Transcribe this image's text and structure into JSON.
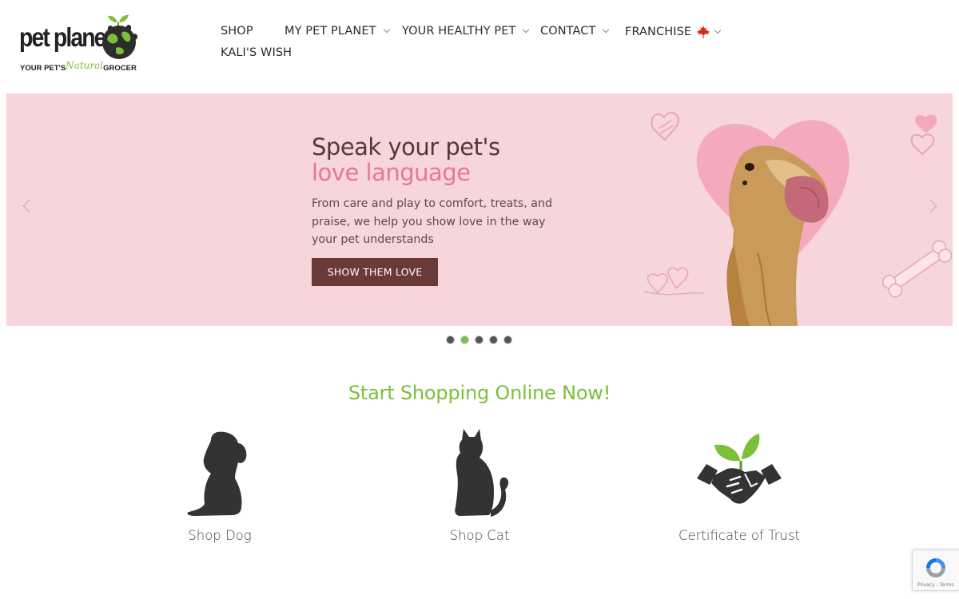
{
  "logo": {
    "brand": "pet planet",
    "tagline_pre": "YOUR PET'S",
    "tagline_script": "Natural",
    "tagline_post": "GROCER"
  },
  "nav": {
    "items": [
      {
        "label": "SHOP",
        "has_dropdown": false
      },
      {
        "label": "MY PET PLANET",
        "has_dropdown": true
      },
      {
        "label": "YOUR HEALTHY PET",
        "has_dropdown": true
      },
      {
        "label": "CONTACT",
        "has_dropdown": true
      },
      {
        "label": "FRANCHISE",
        "has_dropdown": true,
        "icon": "maple-leaf-icon"
      },
      {
        "label": "KALI'S WISH",
        "has_dropdown": false
      }
    ]
  },
  "hero": {
    "title_line1": "Speak your pet's",
    "title_line2": "love language",
    "body": "From care and play to comfort, treats, and praise, we help you show love in the way your pet understands",
    "button_label": "SHOW THEM LOVE",
    "background_color": "#f7d5dd"
  },
  "carousel": {
    "slide_count": 5,
    "active_index": 1
  },
  "shop_section": {
    "title": "Start Shopping Online Now!",
    "cards": [
      {
        "label": "Shop Dog",
        "icon": "dog-silhouette-icon"
      },
      {
        "label": "Shop Cat",
        "icon": "cat-silhouette-icon"
      },
      {
        "label": "Certificate of Trust",
        "icon": "handshake-sprout-icon"
      }
    ]
  },
  "recaptcha": {
    "footer_text": "Privacy - Terms"
  },
  "colors": {
    "accent_green": "#7cbf3a",
    "button_brown": "#6b3a37",
    "title_pink": "#e7788f",
    "title_brown": "#5a3531"
  }
}
